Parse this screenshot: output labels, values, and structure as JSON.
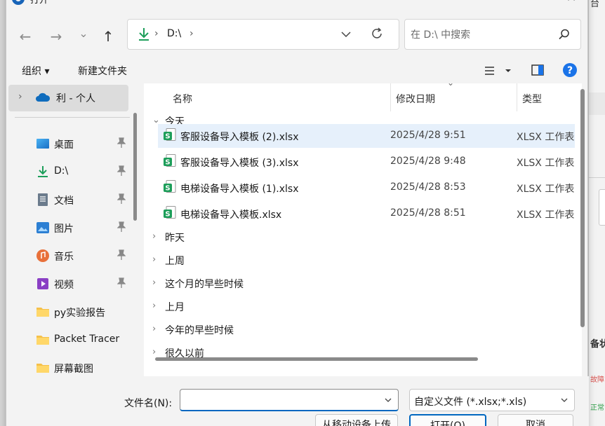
{
  "dialog": {
    "title": "打开",
    "close": "✕"
  },
  "nav": {
    "back": "←",
    "forward": "→",
    "recent": "⌄",
    "up": "↑"
  },
  "address": {
    "path": "D:\\",
    "sep1": "›",
    "sep2": "›"
  },
  "search": {
    "placeholder": "在 D:\\ 中搜索"
  },
  "toolbar": {
    "organize": "组织 ▾",
    "new_folder": "新建文件夹"
  },
  "sidebar": {
    "onedrive": {
      "chevron": "›",
      "label": "利 - 个人"
    },
    "items": [
      {
        "label": "桌面",
        "icon": "desktop-icon",
        "pinned": true
      },
      {
        "label": "D:\\",
        "icon": "download-icon",
        "pinned": true
      },
      {
        "label": "文档",
        "icon": "document-icon",
        "pinned": true
      },
      {
        "label": "图片",
        "icon": "picture-icon",
        "pinned": true
      },
      {
        "label": "音乐",
        "icon": "music-icon",
        "pinned": true
      },
      {
        "label": "视频",
        "icon": "video-icon",
        "pinned": true
      },
      {
        "label": "py实验报告",
        "icon": "folder-icon",
        "pinned": false
      },
      {
        "label": "Packet Tracer",
        "icon": "folder-icon",
        "pinned": false
      },
      {
        "label": "屏幕截图",
        "icon": "folder-icon",
        "pinned": false
      }
    ]
  },
  "columns": {
    "name": "名称",
    "date": "修改日期",
    "type": "类型",
    "sort_arrow": "⌄"
  },
  "groups": {
    "today": {
      "chevron": "⌄",
      "label": "今天"
    },
    "collapsed": [
      {
        "chevron": "›",
        "label": "昨天"
      },
      {
        "chevron": "›",
        "label": "上周"
      },
      {
        "chevron": "›",
        "label": "这个月的早些时候"
      },
      {
        "chevron": "›",
        "label": "上月"
      },
      {
        "chevron": "›",
        "label": "今年的早些时候"
      },
      {
        "chevron": "›",
        "label": "很久以前"
      }
    ]
  },
  "files": [
    {
      "name": "客服设备导入模板 (2).xlsx",
      "date": "2025/4/28 9:51",
      "type": "XLSX 工作表",
      "selected": true
    },
    {
      "name": "客服设备导入模板 (3).xlsx",
      "date": "2025/4/28 9:48",
      "type": "XLSX 工作表",
      "selected": false
    },
    {
      "name": "电梯设备导入模板 (1).xlsx",
      "date": "2025/4/28 8:53",
      "type": "XLSX 工作表",
      "selected": false
    },
    {
      "name": "电梯设备导入模板.xlsx",
      "date": "2025/4/28 8:51",
      "type": "XLSX 工作表",
      "selected": false
    }
  ],
  "bottom": {
    "filename_label": "文件名(N):",
    "filename_value": "",
    "filetype": "自定义文件 (*.xlsx;*.xls)",
    "upload_button": "从移动设备上传",
    "open_button": "打开(O)",
    "cancel_button": "取消"
  },
  "background_app": {
    "top_text": "台",
    "text1": "备状",
    "tag1": "故障",
    "tag2": "正常"
  },
  "colors": {
    "accent": "#0067c0",
    "selection": "#e6f0fb",
    "excel_green": "#1d9e5a",
    "help_blue": "#1a73e8"
  }
}
